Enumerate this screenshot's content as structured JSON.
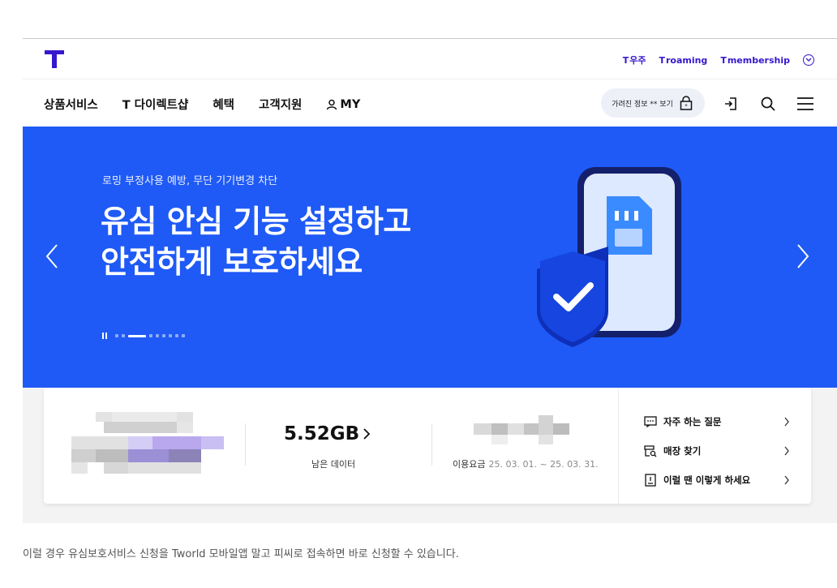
{
  "util_links": [
    {
      "mark": "T",
      "label": "우주"
    },
    {
      "mark": "T",
      "label": "roaming"
    },
    {
      "mark": "T",
      "label": "membership"
    }
  ],
  "gnb": {
    "menu": [
      "상품서비스",
      "T 다이렉트샵",
      "혜택",
      "고객지원",
      "MY"
    ],
    "hide_info_label": "가려진 정보 ** 보기"
  },
  "hero": {
    "subtitle": "로밍 부정사용 예방, 무단 기기변경 차단",
    "title_line1": "유심 안심 기능 설정하고",
    "title_line2": "안전하게 보호하세요",
    "slide_count": 9,
    "active_slide": 3
  },
  "card": {
    "data_value": "5.52GB",
    "data_label": "남은 데이터",
    "fee_label": "이용요금",
    "fee_period": "25. 03. 01. ~ 25. 03. 31.",
    "links": [
      "자주 하는 질문",
      "매장 찾기",
      "이럴 땐 이렇게 하세요"
    ]
  },
  "caption": "이럴 경우 유심보호서비스 신청을 Tworld 모바일앱 말고 피씨로 접속하면 바로 신청할 수 있습니다.",
  "colors": {
    "brand": "#3617ce",
    "hero_bg": "#1f5af6"
  }
}
